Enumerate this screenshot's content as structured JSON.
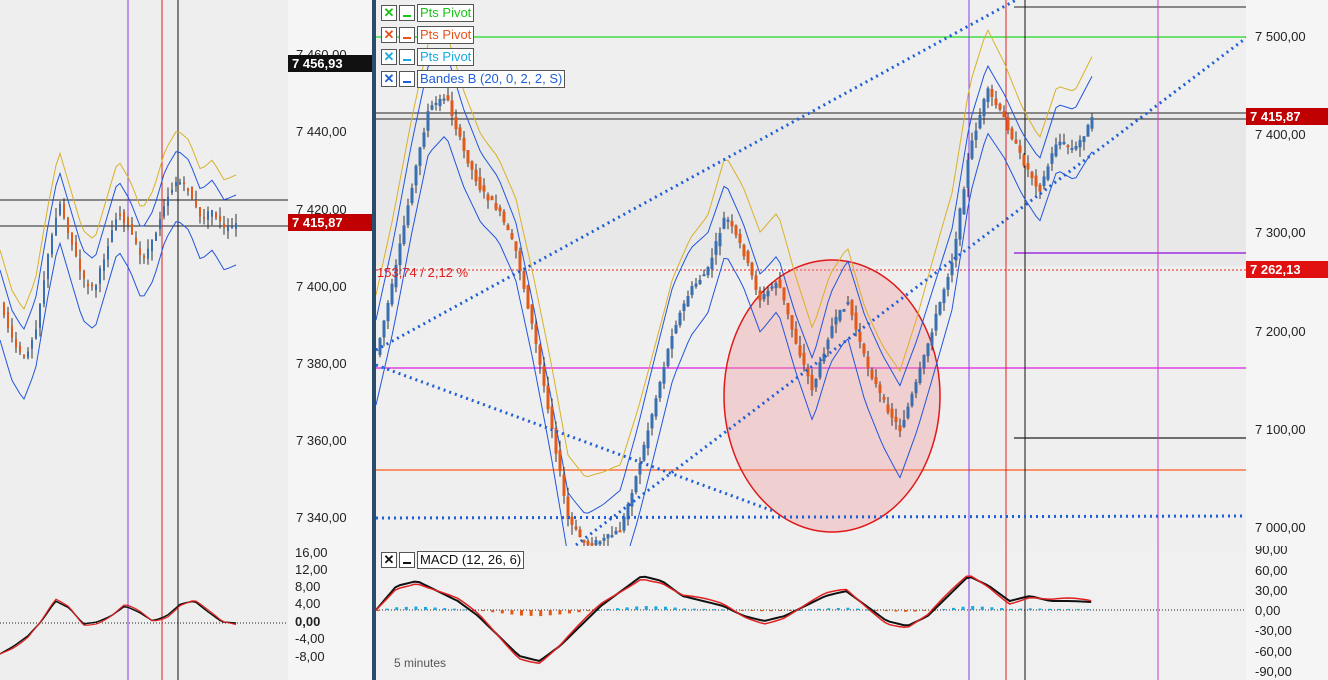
{
  "left_chart": {
    "price_ticks": [
      "7 460,00",
      "7 440,00",
      "7 420,00",
      "7 400,00",
      "7 380,00",
      "7 360,00",
      "7 340,00"
    ],
    "last_price_black": "7 456,93",
    "last_price_red": "7 415,87",
    "macd_ticks": [
      "16,00",
      "12,00",
      "8,00",
      "4,00",
      "0,00",
      "-4,00",
      "-8,00"
    ]
  },
  "main_chart": {
    "legend": [
      {
        "label": "Pts Pivot",
        "color": "#19c219",
        "close_glyph": "✕"
      },
      {
        "label": "Pts Pivot",
        "color": "#e8521c",
        "close_glyph": "✕"
      },
      {
        "label": "Pts Pivot",
        "color": "#17a9e0",
        "close_glyph": "✕"
      },
      {
        "label": "Bandes B (20, 0, 2, 2, S)",
        "color": "#1f5fd6",
        "close_glyph": "✕"
      }
    ],
    "annotation": "153,74 / 2,12 %",
    "price_ticks": [
      "7 500,00",
      "7 400,00",
      "7 300,00",
      "7 200,00",
      "7 100,00",
      "7 000,00"
    ],
    "last_price": "7 415,87",
    "level_price": "7 262,13",
    "macd_label": "MACD (12, 26, 6)",
    "macd_close_glyph": "✕",
    "macd_ticks": [
      "90,00",
      "60,00",
      "30,00",
      "0,00",
      "-30,00",
      "-60,00",
      "-90,00"
    ],
    "timeframe": "5 minutes"
  },
  "colors": {
    "up": "#3a6fb0",
    "down": "#e05a1a",
    "band": "#2255dd",
    "band_outer": "#d8b12a",
    "pivot_green": "#44dd44",
    "pivot_magenta": "#e040e0",
    "pivot_orange": "#ff5a1a",
    "trend_blue": "#1f5fd6",
    "price_red": "#c00000"
  }
}
